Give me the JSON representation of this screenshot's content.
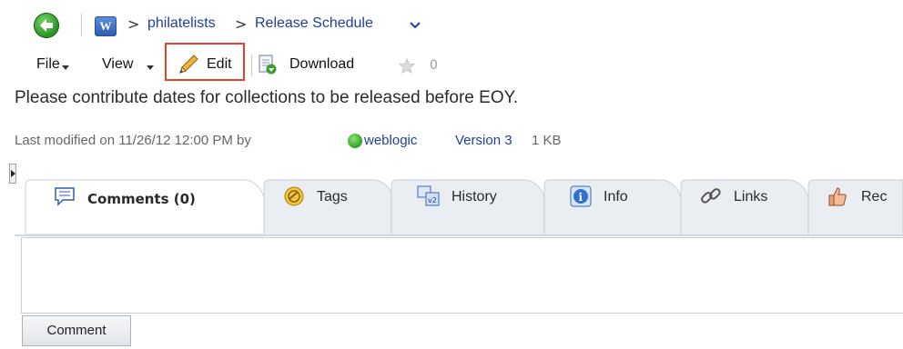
{
  "breadcrumb": {
    "separator": ">",
    "items": [
      "philatelists",
      "Release Schedule"
    ]
  },
  "doc_icon_letter": "W",
  "toolbar": {
    "file_label": "File",
    "view_label": "View",
    "edit_label": "Edit",
    "download_label": "Download",
    "star_count": "0"
  },
  "description": "Please contribute dates for collections to be released before EOY.",
  "meta": {
    "modified_prefix": "Last modified on 11/26/12 12:00 PM  by",
    "user": "weblogic",
    "version": "Version 3",
    "size": "1 KB"
  },
  "tabs": [
    "Comments (0)",
    "Tags",
    "History",
    "Info",
    "Links",
    "Rec"
  ],
  "comment_button_label": "Comment",
  "colors": {
    "link": "#1f3f9a",
    "highlight_box": "#e2442b",
    "status": "#2fa12a"
  }
}
